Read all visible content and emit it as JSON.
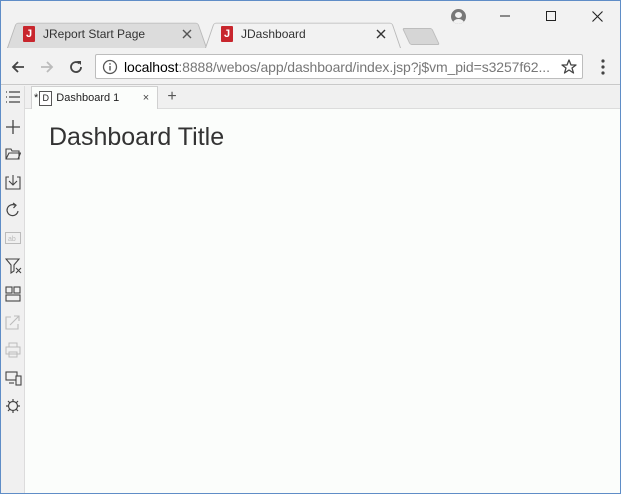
{
  "browser": {
    "tabs": [
      {
        "title": "JReport Start Page",
        "favicon": "J",
        "active": false
      },
      {
        "title": "JDashboard",
        "favicon": "J",
        "active": true
      }
    ],
    "url_host": "localhost",
    "url_path": ":8888/webos/app/dashboard/index.jsp?j$vm_pid=s3257f62..."
  },
  "doc_tabs": {
    "modified_marker": "*",
    "doc_icon_letter": "D",
    "label": "Dashboard 1",
    "close": "×",
    "add": "+"
  },
  "dashboard": {
    "title": "Dashboard Title"
  },
  "colors": {
    "favicon": "#c8262d",
    "window_border": "#5f8dc7"
  }
}
